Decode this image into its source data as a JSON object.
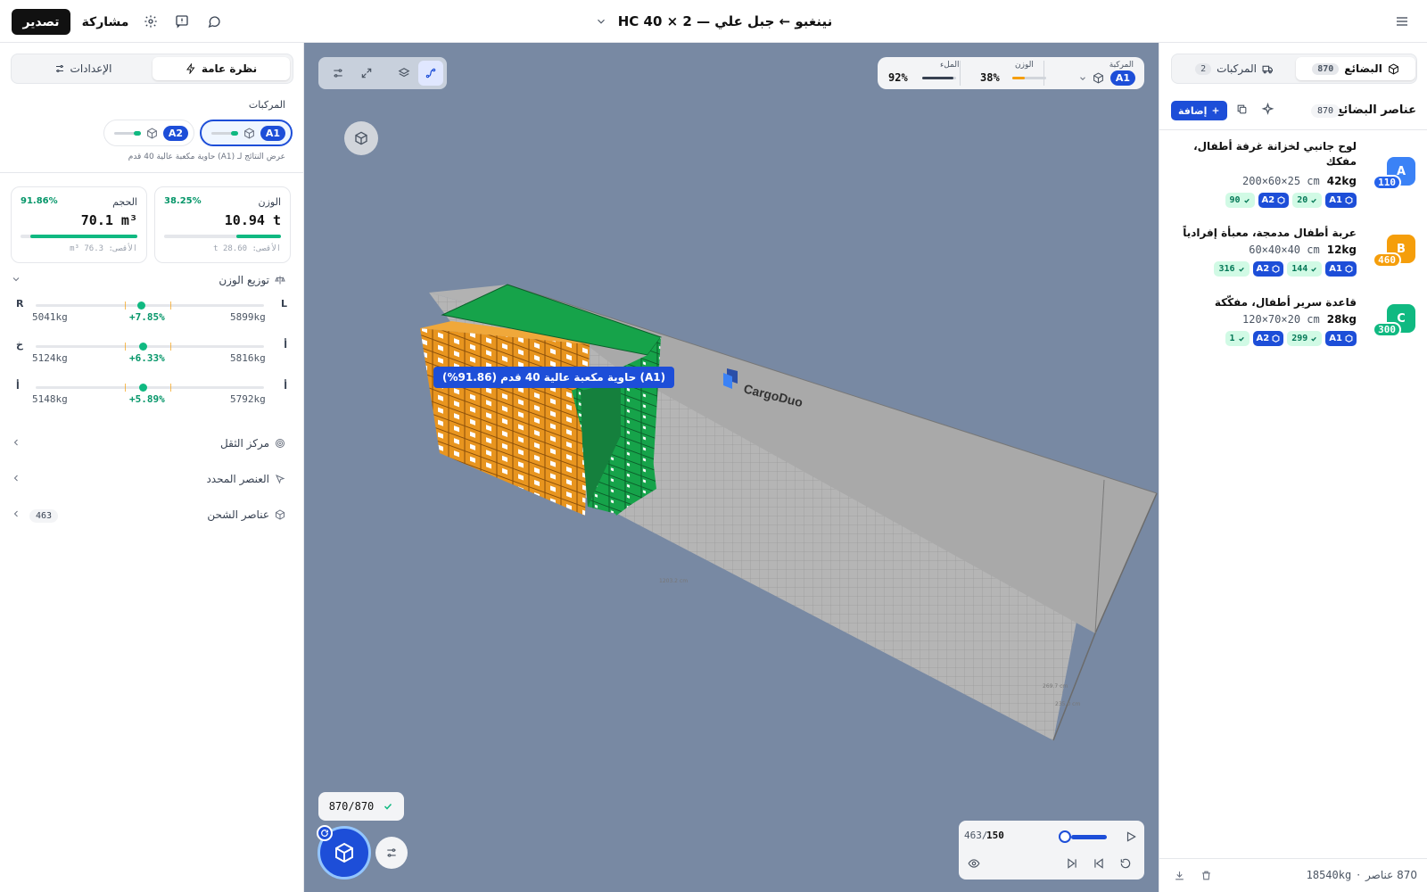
{
  "header": {
    "title": "نينغبو ← جبل علي — 2 × HC 40",
    "export_label": "تصدير",
    "share_label": "مشاركة"
  },
  "left": {
    "tabs": [
      {
        "label": "نظرة عامة",
        "active": true
      },
      {
        "label": "الإعدادات",
        "active": false
      }
    ],
    "vehicles_heading": "المركبات",
    "vehicles": [
      {
        "id": "A1",
        "active": true
      },
      {
        "id": "A2",
        "active": false
      }
    ],
    "results_note": "عرض النتائج لـ (A1) حاوية مكعبة عالية 40 قدم",
    "weight_card": {
      "title": "الوزن",
      "pct": "38.25%",
      "value": "10.94 t",
      "max": "الأقصى: 28.60 t",
      "fill": 0.3825
    },
    "volume_card": {
      "title": "الحجم",
      "pct": "91.86%",
      "value": "70.1 m³",
      "max": "الأقصى: 76.3 m³",
      "fill": 0.9186
    },
    "weight_distribution_label": "توزيع الوزن",
    "balance": [
      {
        "side_left": "R",
        "side_right": "L",
        "left_value": "5041kg",
        "pct": "+7.85%",
        "right_value": "5899kg",
        "dot": 0.46
      },
      {
        "side_left": "خ",
        "side_right": "أ",
        "left_value": "5124kg",
        "pct": "+6.33%",
        "right_value": "5816kg",
        "dot": 0.47
      },
      {
        "side_left": "أ",
        "side_right": "أ",
        "left_value": "5148kg",
        "pct": "+5.89%",
        "right_value": "5792kg",
        "dot": 0.47
      }
    ],
    "center_of_gravity_label": "مركز الثقل",
    "selected_item_label": "العنصر المحدد",
    "shipment_items_label": "عناصر الشحن",
    "shipment_items_count": "463"
  },
  "viewport": {
    "stats": {
      "vehicle_label": "المركبة",
      "vehicle_id": "A1",
      "weight_label": "الوزن",
      "weight_pct": "38%",
      "weight_fill": 0.38,
      "fill_label": "الملء",
      "fill_pct": "92%",
      "fill_fill": 0.92
    },
    "container_label": "(A1) حاوية مكعبة عالية 40 قدم (91.86%)",
    "brand": "CargoDuo",
    "dim_length": "1203.2 cm",
    "dim_height": "269.7 cm",
    "dim_width": "235.0 cm",
    "count_pill": "870/870",
    "player": {
      "current": "150",
      "total": "463/",
      "progress": 0.0
    }
  },
  "right": {
    "tabs": [
      {
        "label": "البضائع",
        "count": "870",
        "active": true
      },
      {
        "label": "المركبات",
        "count": "2",
        "active": false
      }
    ],
    "list_title": "عناصر البضائع",
    "list_count": "870",
    "add_label": "إضافة",
    "items": [
      {
        "letter": "A",
        "color": "#3b82f6",
        "count": "110",
        "count_color": "#2563eb",
        "name": "لوح جانبي لخزانة غرفة أطفال، مفكك",
        "weight": "42kg",
        "dims": "200×60×25 cm",
        "chips": [
          {
            "veh": "A1",
            "count": "20"
          },
          {
            "veh": "A2",
            "count": "90"
          }
        ]
      },
      {
        "letter": "B",
        "color": "#f59e0b",
        "count": "460",
        "count_color": "#f59e0b",
        "name": "عربة أطفال مدمجة، معبأة إفرادياً",
        "weight": "12kg",
        "dims": "60×40×40 cm",
        "chips": [
          {
            "veh": "A1",
            "count": "144"
          },
          {
            "veh": "A2",
            "count": "316"
          }
        ]
      },
      {
        "letter": "C",
        "color": "#10b981",
        "count": "300",
        "count_color": "#10b981",
        "name": "قاعدة سرير أطفال، مفكّكة",
        "weight": "28kg",
        "dims": "120×70×20 cm",
        "chips": [
          {
            "veh": "A1",
            "count": "299"
          },
          {
            "veh": "A2",
            "count": "1"
          }
        ]
      }
    ],
    "footer": {
      "items": "870 عناصر",
      "sep": "·",
      "weight": "18540kg"
    }
  },
  "colors": {
    "accent": "#1d4ed8",
    "success": "#10b981",
    "cargo_orange": "#e8951f",
    "cargo_green": "#16a34a",
    "viewport_bg": "#7889a3"
  }
}
